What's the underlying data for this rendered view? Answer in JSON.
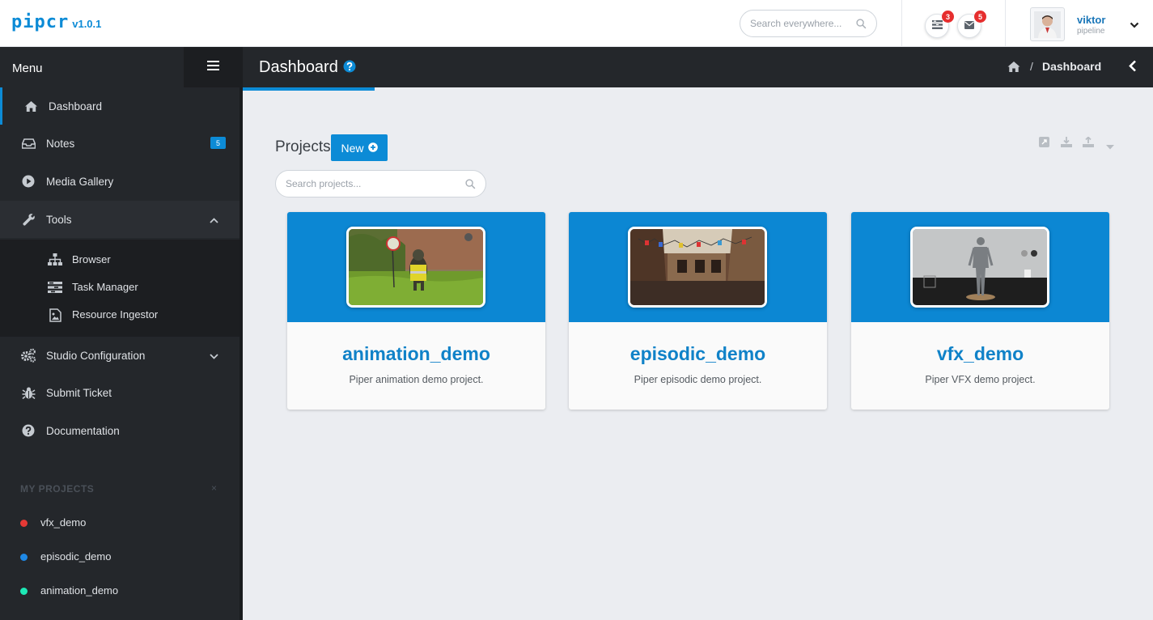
{
  "app": {
    "logo": "pipcr",
    "version": "v1.0.1"
  },
  "topbar": {
    "search_placeholder": "Search everywhere...",
    "tasks_count": "3",
    "messages_count": "5",
    "user_name": "viktor",
    "user_role": "pipeline"
  },
  "sidebar": {
    "menu_title": "Menu",
    "items": [
      {
        "label": "Dashboard",
        "icon": "home-icon"
      },
      {
        "label": "Notes",
        "icon": "inbox-icon",
        "count": "5"
      },
      {
        "label": "Media Gallery",
        "icon": "play-circle-icon"
      },
      {
        "label": "Tools",
        "icon": "wrench-icon"
      },
      {
        "label": "Studio Configuration",
        "icon": "cogs-icon"
      },
      {
        "label": "Submit Ticket",
        "icon": "bug-icon"
      },
      {
        "label": "Documentation",
        "icon": "question-circle-icon"
      }
    ],
    "tools_sub": [
      {
        "label": "Browser",
        "icon": "sitemap-icon"
      },
      {
        "label": "Task Manager",
        "icon": "tasks-icon"
      },
      {
        "label": "Resource Ingestor",
        "icon": "file-image-icon"
      }
    ],
    "my_projects_title": "MY PROJECTS",
    "my_projects_close": "×",
    "my_projects": [
      {
        "label": "vfx_demo",
        "color": "#e53935"
      },
      {
        "label": "episodic_demo",
        "color": "#1e88e5"
      },
      {
        "label": "animation_demo",
        "color": "#1de9b6"
      }
    ]
  },
  "header": {
    "title": "Dashboard",
    "breadcrumb_current": "Dashboard",
    "breadcrumb_sep": "/"
  },
  "projects": {
    "title": "Projects",
    "new_label": "New",
    "search_placeholder": "Search projects...",
    "cards": [
      {
        "name": "animation_demo",
        "description": "Piper animation demo project."
      },
      {
        "name": "episodic_demo",
        "description": "Piper episodic demo project."
      },
      {
        "name": "vfx_demo",
        "description": "Piper VFX demo project."
      }
    ]
  },
  "colors": {
    "accent": "#0c8bd6",
    "sidebar_bg": "#24272b",
    "content_bg": "#ebedf1"
  }
}
